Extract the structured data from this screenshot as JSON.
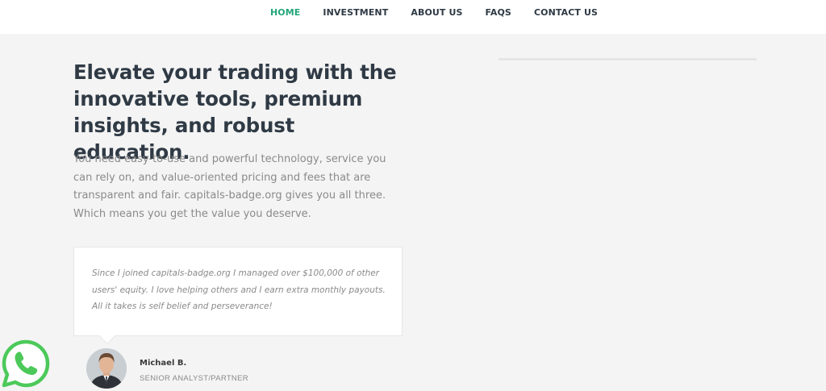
{
  "nav": {
    "items": [
      {
        "label": "HOME"
      },
      {
        "label": "INVESTMENT"
      },
      {
        "label": "ABOUT US"
      },
      {
        "label": "FAQS"
      },
      {
        "label": "CONTACT US"
      }
    ],
    "active_color": "#22a67a"
  },
  "hero": {
    "title": "Elevate your trading with the innovative tools, premium insights, and robust education.",
    "description": "You need easy-to-use and powerful technology, service you can rely on, and value-oriented pricing and fees that are transparent and fair. capitals-badge.org gives you all three. Which means you get the value you deserve."
  },
  "testimonial": {
    "quote": "Since I joined capitals-badge.org I managed over $100,000 of other users' equity. I love helping others and I earn extra monthly payouts. All it takes is self belief and perseverance!",
    "author_name": "Michael B.",
    "author_role": "SENIOR ANALYST/PARTNER"
  },
  "floating": {
    "whatsapp_icon": "whatsapp-icon",
    "whatsapp_color": "#4cc95a"
  }
}
